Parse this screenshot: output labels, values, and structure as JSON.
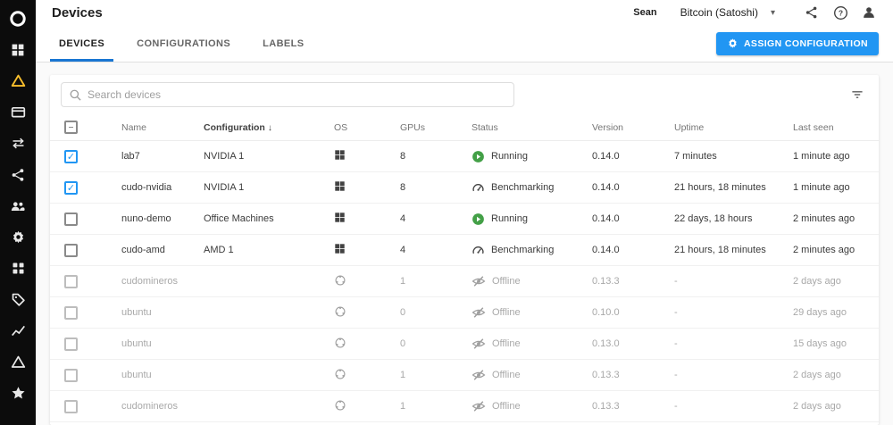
{
  "header": {
    "title": "Devices",
    "user_name": "Sean",
    "wallet_label": "Bitcoin (Satoshi)",
    "caret": "▾"
  },
  "sidebar": {
    "icons": [
      "cudo-logo",
      "dashboard",
      "compute-triangle",
      "billing-card",
      "transactions",
      "network-nodes",
      "team",
      "settings",
      "apps-grid",
      "labels-tag",
      "stats-chart",
      "alerts-triangle",
      "favorites-star"
    ]
  },
  "tabs": {
    "items": [
      {
        "label": "DEVICES",
        "active": true
      },
      {
        "label": "CONFIGURATIONS",
        "active": false
      },
      {
        "label": "LABELS",
        "active": false
      }
    ]
  },
  "toolbar": {
    "assign_label": "ASSIGN CONFIGURATION"
  },
  "search": {
    "placeholder": "Search devices"
  },
  "colors": {
    "accent_blue": "#2196f3",
    "tab_underline": "#1976d2",
    "running_green": "#43a047",
    "amber": "#fbc02d",
    "sidebar_bg": "#0c0c0c"
  },
  "table": {
    "columns": [
      "Name",
      "Configuration",
      "OS",
      "GPUs",
      "Status",
      "Version",
      "Uptime",
      "Last seen"
    ],
    "sort_column": "Configuration",
    "sort_indicator": "↓",
    "rows": [
      {
        "name": "lab7",
        "configuration": "NVIDIA 1",
        "os": "windows",
        "gpus": "8",
        "status": "Running",
        "status_type": "running",
        "version": "0.14.0",
        "uptime": "7 minutes",
        "last_seen": "1 minute ago",
        "checked": true,
        "offline": false
      },
      {
        "name": "cudo-nvidia",
        "configuration": "NVIDIA 1",
        "os": "windows",
        "gpus": "8",
        "status": "Benchmarking",
        "status_type": "benchmarking",
        "version": "0.14.0",
        "uptime": "21 hours, 18 minutes",
        "last_seen": "1 minute ago",
        "checked": true,
        "offline": false
      },
      {
        "name": "nuno-demo",
        "configuration": "Office Machines",
        "os": "windows",
        "gpus": "4",
        "status": "Running",
        "status_type": "running",
        "version": "0.14.0",
        "uptime": "22 days, 18 hours",
        "last_seen": "2 minutes ago",
        "checked": false,
        "offline": false
      },
      {
        "name": "cudo-amd",
        "configuration": "AMD 1",
        "os": "windows",
        "gpus": "4",
        "status": "Benchmarking",
        "status_type": "benchmarking",
        "version": "0.14.0",
        "uptime": "21 hours, 18 minutes",
        "last_seen": "2 minutes ago",
        "checked": false,
        "offline": false
      },
      {
        "name": "cudomineros",
        "configuration": "",
        "os": "linux",
        "gpus": "1",
        "status": "Offline",
        "status_type": "offline",
        "version": "0.13.3",
        "uptime": "-",
        "last_seen": "2 days ago",
        "checked": false,
        "offline": true
      },
      {
        "name": "ubuntu",
        "configuration": "",
        "os": "linux",
        "gpus": "0",
        "status": "Offline",
        "status_type": "offline",
        "version": "0.10.0",
        "uptime": "-",
        "last_seen": "29 days ago",
        "checked": false,
        "offline": true
      },
      {
        "name": "ubuntu",
        "configuration": "",
        "os": "linux",
        "gpus": "0",
        "status": "Offline",
        "status_type": "offline",
        "version": "0.13.0",
        "uptime": "-",
        "last_seen": "15 days ago",
        "checked": false,
        "offline": true
      },
      {
        "name": "ubuntu",
        "configuration": "",
        "os": "linux",
        "gpus": "1",
        "status": "Offline",
        "status_type": "offline",
        "version": "0.13.3",
        "uptime": "-",
        "last_seen": "2 days ago",
        "checked": false,
        "offline": true
      },
      {
        "name": "cudomineros",
        "configuration": "",
        "os": "linux",
        "gpus": "1",
        "status": "Offline",
        "status_type": "offline",
        "version": "0.13.3",
        "uptime": "-",
        "last_seen": "2 days ago",
        "checked": false,
        "offline": true
      }
    ]
  }
}
